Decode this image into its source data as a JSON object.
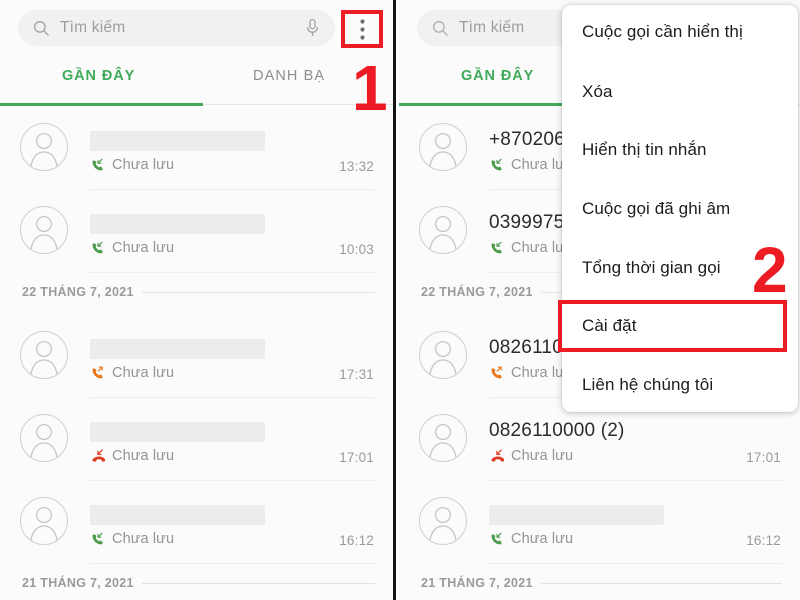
{
  "search": {
    "placeholder": "Tìm kiếm",
    "search_icon": "search-icon",
    "mic_icon": "microphone-icon",
    "overflow_icon": "more-vertical-icon"
  },
  "tabs": {
    "recent": "GẦN ĐÂY",
    "contacts": "DANH BẠ"
  },
  "left_panel": {
    "items": [
      {
        "kind": "call",
        "name": "",
        "redacted": true,
        "status": "Chưa lưu",
        "time": "13:32",
        "calltype": "incoming"
      },
      {
        "kind": "call",
        "name": "",
        "redacted": true,
        "status": "Chưa lưu",
        "time": "10:03",
        "calltype": "incoming"
      },
      {
        "kind": "date",
        "label": "22 THÁNG 7, 2021"
      },
      {
        "kind": "call",
        "name": "",
        "redacted": true,
        "status": "Chưa lưu",
        "time": "17:31",
        "calltype": "outgoing"
      },
      {
        "kind": "call",
        "name": "",
        "redacted": true,
        "status": "Chưa lưu",
        "time": "17:01",
        "calltype": "missed"
      },
      {
        "kind": "call",
        "name": "",
        "redacted": true,
        "status": "Chưa lưu",
        "time": "16:12",
        "calltype": "incoming"
      },
      {
        "kind": "date",
        "label": "21 THÁNG 7, 2021"
      }
    ]
  },
  "right_panel": {
    "items": [
      {
        "kind": "call",
        "name": "+870206",
        "redacted": false,
        "status": "Chưa lưu",
        "time": "",
        "calltype": "incoming"
      },
      {
        "kind": "call",
        "name": "0399975",
        "redacted": false,
        "status": "Chưa lưu",
        "time": "",
        "calltype": "incoming"
      },
      {
        "kind": "date",
        "label": "22 THÁNG 7, 2021"
      },
      {
        "kind": "call",
        "name": "0826110",
        "redacted": false,
        "status": "Chưa lưu",
        "time": "",
        "calltype": "outgoing"
      },
      {
        "kind": "call",
        "name": "0826110000 (2)",
        "redacted": false,
        "status": "Chưa lưu",
        "time": "17:01",
        "calltype": "missed"
      },
      {
        "kind": "call",
        "name": "",
        "redacted": true,
        "status": "Chưa lưu",
        "time": "16:12",
        "calltype": "incoming"
      },
      {
        "kind": "date",
        "label": "21 THÁNG 7, 2021"
      }
    ]
  },
  "menu": {
    "items": [
      {
        "label": "Cuộc gọi cần hiển thị"
      },
      {
        "label": "Xóa"
      },
      {
        "label": "Hiển thị tin nhắn"
      },
      {
        "label": "Cuộc gọi đã ghi âm"
      },
      {
        "label": "Tổng thời gian gọi"
      },
      {
        "label": "Cài đặt"
      },
      {
        "label": "Liên hệ chúng tôi"
      }
    ]
  },
  "annotations": {
    "step1": "1",
    "step2": "2",
    "color": "#ed1c24"
  },
  "colors": {
    "accent_green": "#3fab5a",
    "incoming": "#4c9a4c",
    "outgoing": "#e8761a",
    "missed": "#e03a20",
    "panel_bg": "#fbfbfb"
  }
}
